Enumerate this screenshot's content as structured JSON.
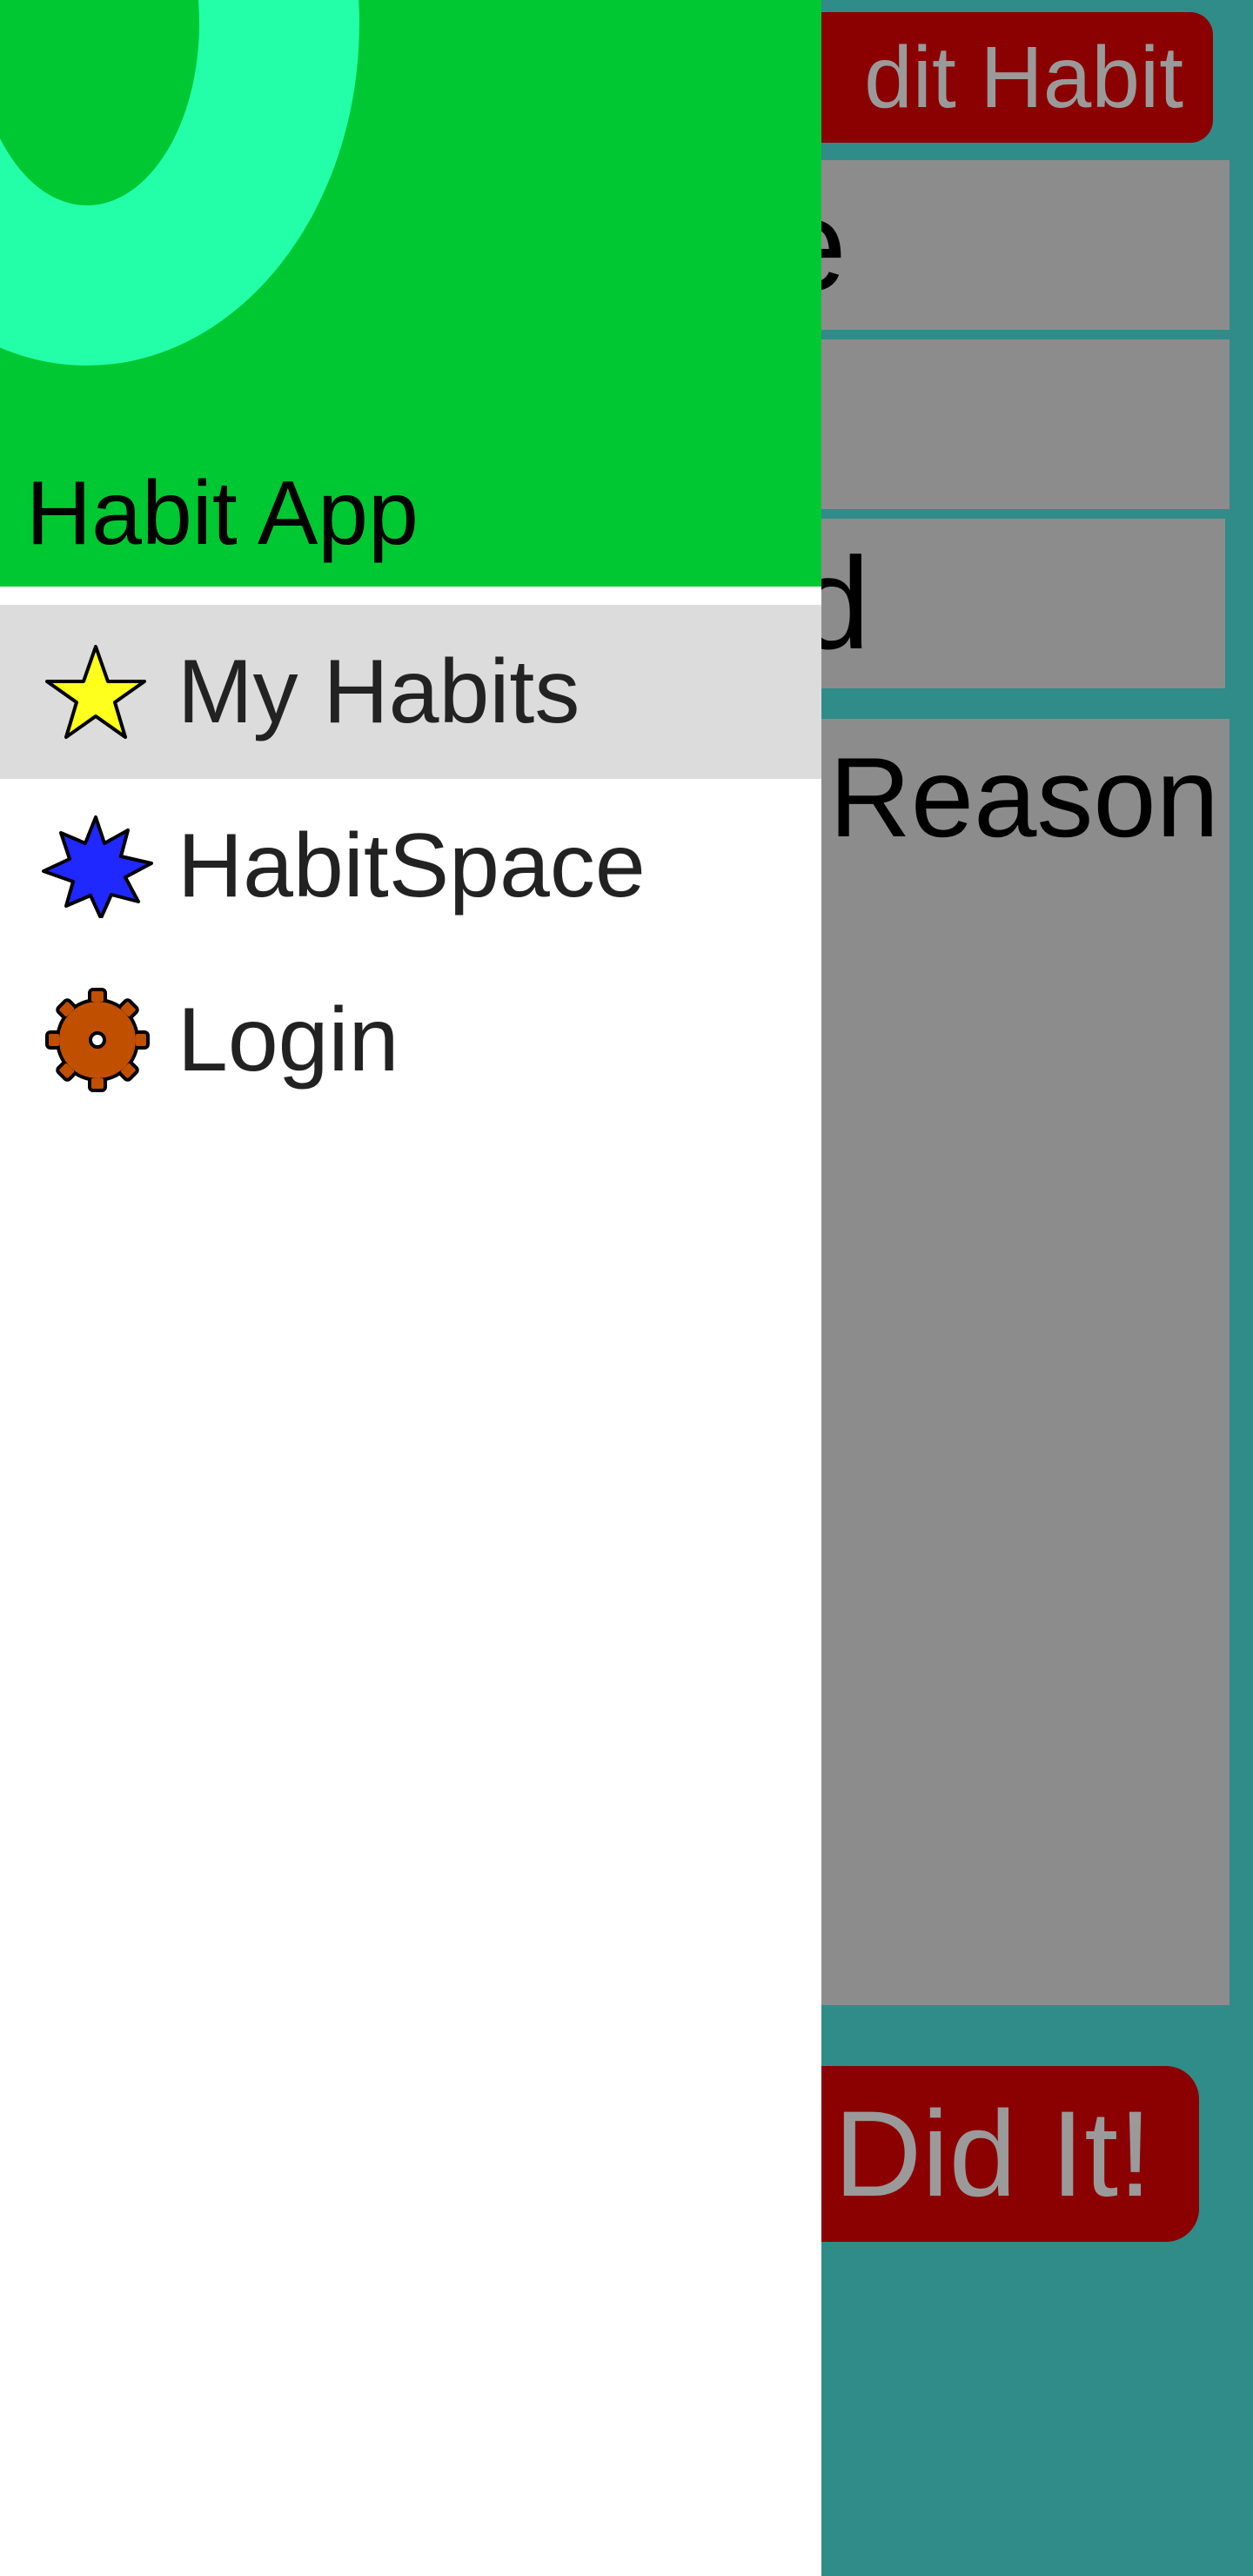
{
  "background": {
    "edit_habit_label": "dit Habit",
    "name_field_text": "e",
    "weekdays_field_text": "d",
    "reason_field_text": "Reason",
    "did_it_label": "Did It!"
  },
  "drawer": {
    "app_title": "Habit App",
    "items": [
      {
        "label": "My Habits",
        "icon": "star-icon",
        "icon_color": "#ffff1e",
        "selected": true
      },
      {
        "label": "HabitSpace",
        "icon": "starburst-icon",
        "icon_color": "#1e28ff",
        "selected": false
      },
      {
        "label": "Login",
        "icon": "gear-icon",
        "icon_color": "#c05000",
        "selected": false
      }
    ]
  },
  "colors": {
    "background_teal": "#2f8c89",
    "button_red": "#8b0000",
    "field_gray": "#8c8c8c",
    "drawer_header_green": "#00c832",
    "header_ring_mint": "#22ffa8",
    "selected_row_gray": "#dcdcdc"
  }
}
